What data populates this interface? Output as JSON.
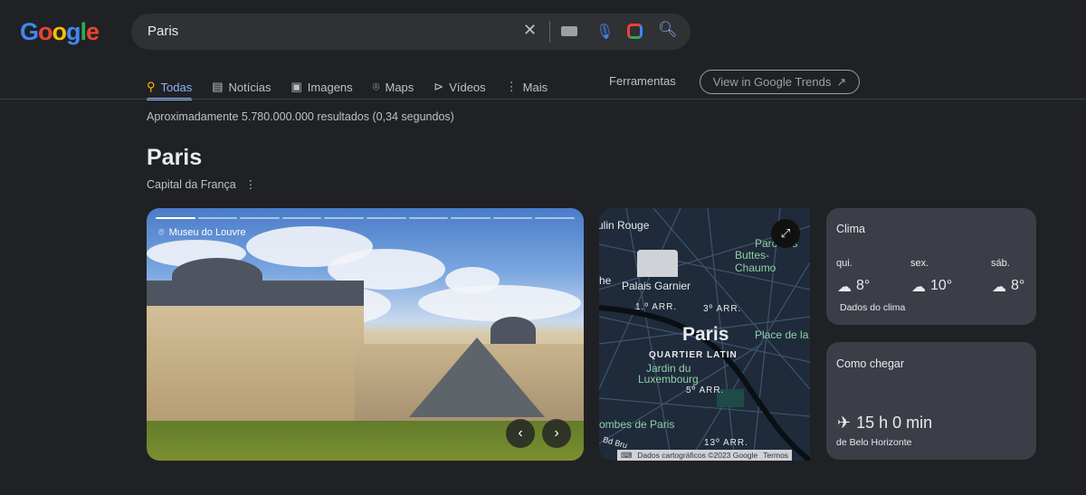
{
  "logo": "Google",
  "search": {
    "query": "Paris"
  },
  "tabs": [
    {
      "label": "Todas",
      "icon": "search-icon",
      "active": true
    },
    {
      "label": "Notícias",
      "icon": "news-icon"
    },
    {
      "label": "Imagens",
      "icon": "image-icon"
    },
    {
      "label": "Maps",
      "icon": "pin-icon"
    },
    {
      "label": "Vídeos",
      "icon": "play-icon"
    },
    {
      "label": "Mais",
      "icon": "more-vert-icon"
    }
  ],
  "tools": "Ferramentas",
  "trends": "View in Google Trends",
  "stats": "Aproximadamente 5.780.000.000 resultados (0,34 segundos)",
  "entity": {
    "title": "Paris",
    "subtitle": "Capital da França"
  },
  "photo": {
    "location": "Museu do Louvre",
    "slides": 10,
    "current": 1
  },
  "map": {
    "labels": [
      "ulin Rouge",
      "Parc des",
      "Buttes-Chaumo",
      "Palais Garnier",
      "he",
      "1.º ARR.",
      "3º ARR.",
      "Paris",
      "Place de la",
      "QUARTIER LATIN",
      "Jardin du",
      "Luxembourg",
      "5º ARR.",
      "ombes de Paris",
      "13º ARR.",
      "Bd Bru"
    ],
    "attribution": "Dados cartográficos ©2023 Google",
    "terms": "Termos"
  },
  "weather": {
    "title": "Clima",
    "days": [
      {
        "day": "qui.",
        "temp": "8°"
      },
      {
        "day": "sex.",
        "temp": "10°"
      },
      {
        "day": "sáb.",
        "temp": "8°"
      }
    ],
    "source": "Dados do clima"
  },
  "directions": {
    "title": "Como chegar",
    "duration": "15 h 0 min",
    "from": "de Belo Horizonte"
  },
  "colors": {
    "accent": "#8ab4f8",
    "background": "#202124",
    "card": "#3b3e47"
  }
}
